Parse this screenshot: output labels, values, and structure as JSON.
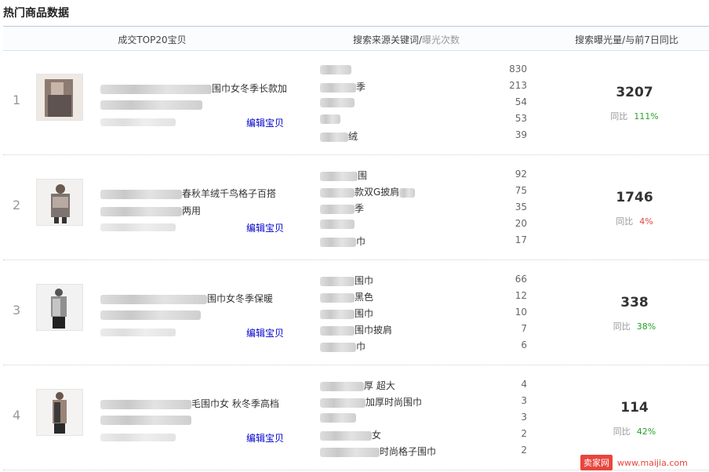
{
  "title": "热门商品数据",
  "header": {
    "col_items": "成交TOP20宝贝",
    "col_keywords_main": "搜索来源关键词/",
    "col_keywords_sub": "曝光次数",
    "col_stats": "搜索曝光量/与前7日同比"
  },
  "colors": {
    "link": "#0000cc",
    "positive": "#2aa12a",
    "warn": "#e8453c",
    "muted": "#999999"
  },
  "rows": [
    {
      "rank": "1",
      "title_line1_suffix": "围巾女冬季长款加",
      "edit_label": "编辑宝贝",
      "keywords": [
        {
          "suffix": "",
          "count": "830"
        },
        {
          "suffix": "季",
          "count": "213"
        },
        {
          "suffix": "",
          "count": "54"
        },
        {
          "suffix": "",
          "count": "53"
        },
        {
          "suffix": "绒",
          "count": "39"
        }
      ],
      "exposure": "3207",
      "yoy_label": "同比",
      "yoy_value": "111%",
      "yoy_color": "#2aa12a"
    },
    {
      "rank": "2",
      "title_line1_suffix": "春秋羊绒千鸟格子百搭",
      "title_line2_suffix": "两用",
      "edit_label": "编辑宝贝",
      "keywords": [
        {
          "suffix": "围",
          "count": "92"
        },
        {
          "suffix": "款双G披肩",
          "count": "75"
        },
        {
          "suffix": "季",
          "count": "35"
        },
        {
          "suffix": "",
          "count": "20"
        },
        {
          "suffix": "巾",
          "count": "17"
        }
      ],
      "exposure": "1746",
      "yoy_label": "同比",
      "yoy_value": "4%",
      "yoy_color": "#e8453c"
    },
    {
      "rank": "3",
      "title_line1_suffix": "围巾女冬季保暖",
      "edit_label": "编辑宝贝",
      "keywords": [
        {
          "suffix": "围巾",
          "count": "66"
        },
        {
          "suffix": "黑色",
          "count": "12"
        },
        {
          "suffix": "围巾",
          "count": "10"
        },
        {
          "suffix": "围巾披肩",
          "count": "7"
        },
        {
          "suffix": "巾",
          "count": "6"
        }
      ],
      "exposure": "338",
      "yoy_label": "同比",
      "yoy_value": "38%",
      "yoy_color": "#2aa12a"
    },
    {
      "rank": "4",
      "title_line1_suffix": "毛围巾女 秋冬季高档",
      "edit_label": "编辑宝贝",
      "keywords": [
        {
          "suffix": "厚 超大",
          "count": "4"
        },
        {
          "suffix": "加厚时尚围巾",
          "count": "3"
        },
        {
          "suffix": "",
          "count": "3"
        },
        {
          "suffix": "女",
          "count": "2"
        },
        {
          "suffix": "时尚格子围巾",
          "count": "2"
        }
      ],
      "exposure": "114",
      "yoy_label": "同比",
      "yoy_value": "42%",
      "yoy_color": "#2aa12a"
    }
  ],
  "watermark": {
    "logo": "卖家网",
    "url": "www.maijia.com"
  }
}
